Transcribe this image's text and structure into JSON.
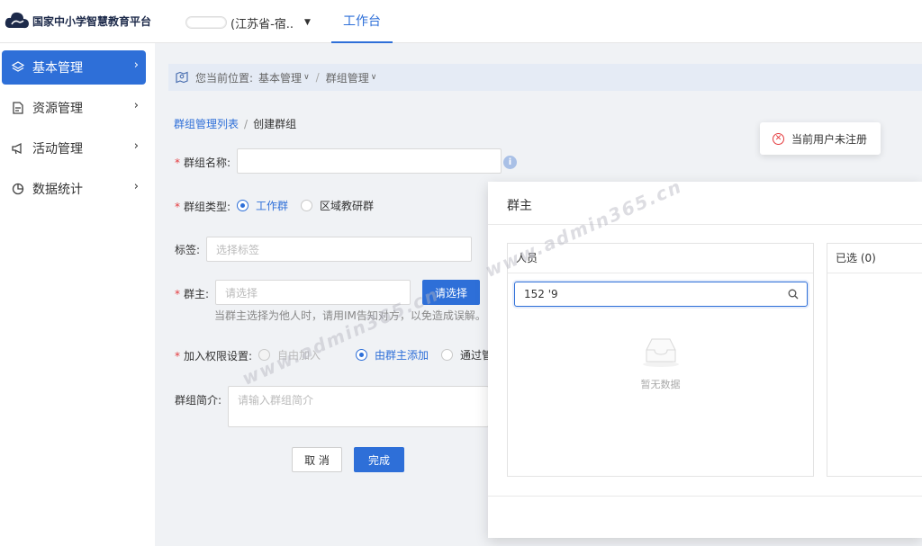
{
  "header": {
    "brand": "国家中小学智慧教育平台",
    "region": "(江苏省-宿..",
    "tab": "工作台"
  },
  "sidebar": {
    "items": [
      {
        "label": "基本管理",
        "icon": "layers-icon",
        "active": true
      },
      {
        "label": "资源管理",
        "icon": "document-icon",
        "active": false
      },
      {
        "label": "活动管理",
        "icon": "megaphone-icon",
        "active": false
      },
      {
        "label": "数据统计",
        "icon": "pie-chart-icon",
        "active": false
      }
    ]
  },
  "location": {
    "prefix": "您当前位置:",
    "level1": "基本管理",
    "separator": "/",
    "level2": "群组管理"
  },
  "crumb": {
    "list": "群组管理列表",
    "separator": "/",
    "current": "创建群组"
  },
  "form": {
    "name_label": "群组名称:",
    "type_label": "群组类型:",
    "type_options": [
      "工作群",
      "区域教研群"
    ],
    "tag_label": "标签:",
    "tag_placeholder": "选择标签",
    "owner_label": "群主:",
    "owner_placeholder": "请选择",
    "owner_button": "请选择",
    "owner_hint": "当群主选择为他人时，请用IM告知对方，以免造成误解。",
    "permission_label": "加入权限设置:",
    "permission_options": [
      "自由加入",
      "由群主添加",
      "通过管"
    ],
    "intro_label": "群组简介:",
    "intro_placeholder": "请输入群组简介",
    "cancel": "取 消",
    "submit": "完成"
  },
  "toast": {
    "text": "当前用户未注册"
  },
  "modal": {
    "title": "群主",
    "people_title": "人员",
    "search_value": "152         '9",
    "empty_text": "暂无数据",
    "selected_title": "已选 (0)"
  },
  "watermark": "www.admin365.cn",
  "colors": {
    "primary": "#2e6fd8",
    "danger": "#e4393c"
  }
}
